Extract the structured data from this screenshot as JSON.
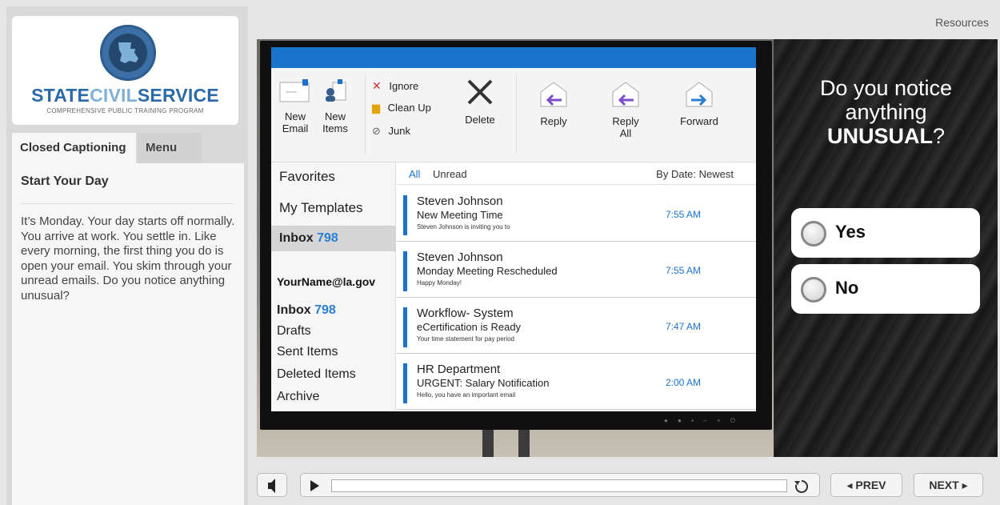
{
  "header": {
    "resources": "Resources"
  },
  "logo": {
    "title_a": "STATE",
    "title_b": "CIVIL",
    "title_c": "SERVICE",
    "subtitle": "COMPREHENSIVE PUBLIC TRAINING PROGRAM"
  },
  "sidebar": {
    "tabs": [
      "Closed Captioning",
      "Menu"
    ],
    "cc_title": "Start Your Day",
    "cc_text": "It’s Monday. Your day starts off normally. You arrive at work. You settle in. Like every morning, the first thing you do is open your email. You skim through your unread emails. Do you notice anything unusual?"
  },
  "email": {
    "ribbon": {
      "new_email": [
        "New",
        "Email"
      ],
      "new_items": [
        "New",
        "Items"
      ],
      "ignore": "Ignore",
      "clean_up": "Clean Up",
      "junk": "Junk",
      "delete": "Delete",
      "reply": "Reply",
      "reply_all": [
        "Reply",
        "All"
      ],
      "forward": "Forward"
    },
    "nav": {
      "favorites": "Favorites",
      "templates": "My Templates",
      "inbox_label": "Inbox",
      "inbox_count": "798",
      "account": "YourName@la.gov",
      "folders": [
        "Drafts",
        "Sent Items",
        "Deleted Items",
        "Archive"
      ]
    },
    "filters": {
      "all": "All",
      "unread": "Unread",
      "sort": "By Date: Newest"
    },
    "messages": [
      {
        "from": "Steven Johnson",
        "subject": "New Meeting Time",
        "preview": "Steven Johnson is inviting you to",
        "time": "7:55 AM"
      },
      {
        "from": "Steven Johnson",
        "subject": "Monday Meeting Rescheduled",
        "preview": "Happy Monday!",
        "time": "7:55 AM"
      },
      {
        "from": "Workflow- System",
        "subject": "eCertification is Ready",
        "preview": "Your time statement for pay period",
        "time": "7:47 AM"
      },
      {
        "from": "HR Department",
        "subject": "URGENT: Salary Notification",
        "preview": "Hello, you have an important email",
        "time": "2:00 AM"
      }
    ]
  },
  "question": {
    "line1": "Do you notice",
    "line2": "anything",
    "emph": "UNUSUAL",
    "end": "?",
    "answers": [
      "Yes",
      "No"
    ]
  },
  "player": {
    "prev": "◂ PREV",
    "next": "NEXT ▸"
  },
  "colors": {
    "accent": "#1a73cc",
    "brand": "#2b6aa8"
  }
}
